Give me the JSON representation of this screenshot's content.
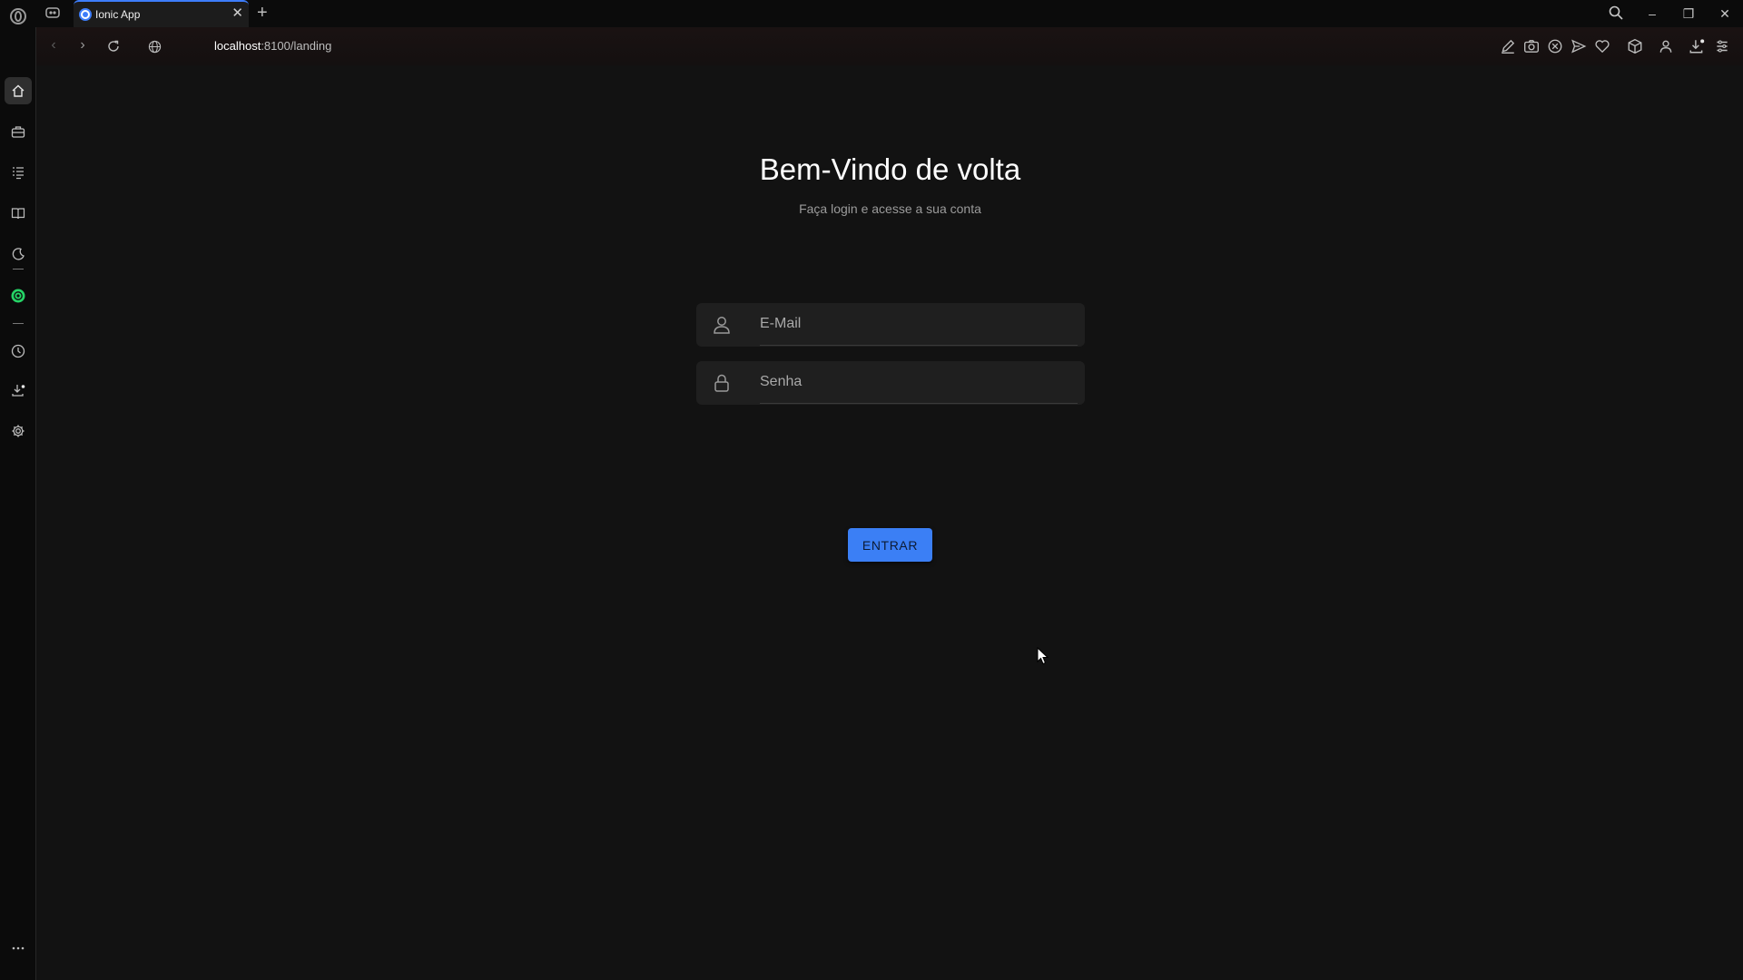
{
  "browser": {
    "tab": {
      "title": "Ionic App",
      "close_glyph": "✕"
    },
    "new_tab_glyph": "+",
    "window_controls": {
      "minimize": "–",
      "restore": "❐",
      "close": "✕"
    },
    "url": {
      "host": "localhost",
      "rest": ":8100/landing"
    },
    "accent_color": "#3d7dfa"
  },
  "sidebar": {
    "items": [
      {
        "icon": "home-icon",
        "active": true
      },
      {
        "icon": "briefcase-icon"
      },
      {
        "icon": "list-icon"
      },
      {
        "icon": "book-icon"
      },
      {
        "icon": "moon-icon"
      },
      {
        "icon": "whatsapp-icon",
        "color": "#25d366"
      },
      {
        "icon": "clock-icon"
      },
      {
        "icon": "download-icon"
      },
      {
        "icon": "gear-icon"
      },
      {
        "icon": "more-icon"
      }
    ]
  },
  "login": {
    "title": "Bem-Vindo de volta",
    "subtitle": "Faça login e acesse a sua conta",
    "email_placeholder": "E-Mail",
    "password_placeholder": "Senha",
    "submit_label": "ENTRAR",
    "button_color": "#3b7ff5"
  }
}
